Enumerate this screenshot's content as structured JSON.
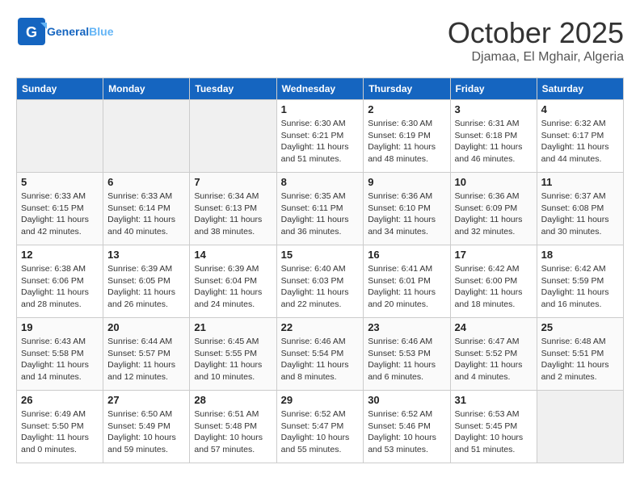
{
  "logo": {
    "text_general": "General",
    "text_blue": "Blue"
  },
  "title": {
    "month_year": "October 2025",
    "location": "Djamaa, El Mghair, Algeria"
  },
  "weekdays": [
    "Sunday",
    "Monday",
    "Tuesday",
    "Wednesday",
    "Thursday",
    "Friday",
    "Saturday"
  ],
  "weeks": [
    {
      "days": [
        {
          "num": "",
          "empty": true
        },
        {
          "num": "",
          "empty": true
        },
        {
          "num": "",
          "empty": true
        },
        {
          "num": "1",
          "sunrise": "Sunrise: 6:30 AM",
          "sunset": "Sunset: 6:21 PM",
          "daylight": "Daylight: 11 hours and 51 minutes."
        },
        {
          "num": "2",
          "sunrise": "Sunrise: 6:30 AM",
          "sunset": "Sunset: 6:19 PM",
          "daylight": "Daylight: 11 hours and 48 minutes."
        },
        {
          "num": "3",
          "sunrise": "Sunrise: 6:31 AM",
          "sunset": "Sunset: 6:18 PM",
          "daylight": "Daylight: 11 hours and 46 minutes."
        },
        {
          "num": "4",
          "sunrise": "Sunrise: 6:32 AM",
          "sunset": "Sunset: 6:17 PM",
          "daylight": "Daylight: 11 hours and 44 minutes."
        }
      ]
    },
    {
      "days": [
        {
          "num": "5",
          "sunrise": "Sunrise: 6:33 AM",
          "sunset": "Sunset: 6:15 PM",
          "daylight": "Daylight: 11 hours and 42 minutes."
        },
        {
          "num": "6",
          "sunrise": "Sunrise: 6:33 AM",
          "sunset": "Sunset: 6:14 PM",
          "daylight": "Daylight: 11 hours and 40 minutes."
        },
        {
          "num": "7",
          "sunrise": "Sunrise: 6:34 AM",
          "sunset": "Sunset: 6:13 PM",
          "daylight": "Daylight: 11 hours and 38 minutes."
        },
        {
          "num": "8",
          "sunrise": "Sunrise: 6:35 AM",
          "sunset": "Sunset: 6:11 PM",
          "daylight": "Daylight: 11 hours and 36 minutes."
        },
        {
          "num": "9",
          "sunrise": "Sunrise: 6:36 AM",
          "sunset": "Sunset: 6:10 PM",
          "daylight": "Daylight: 11 hours and 34 minutes."
        },
        {
          "num": "10",
          "sunrise": "Sunrise: 6:36 AM",
          "sunset": "Sunset: 6:09 PM",
          "daylight": "Daylight: 11 hours and 32 minutes."
        },
        {
          "num": "11",
          "sunrise": "Sunrise: 6:37 AM",
          "sunset": "Sunset: 6:08 PM",
          "daylight": "Daylight: 11 hours and 30 minutes."
        }
      ]
    },
    {
      "days": [
        {
          "num": "12",
          "sunrise": "Sunrise: 6:38 AM",
          "sunset": "Sunset: 6:06 PM",
          "daylight": "Daylight: 11 hours and 28 minutes."
        },
        {
          "num": "13",
          "sunrise": "Sunrise: 6:39 AM",
          "sunset": "Sunset: 6:05 PM",
          "daylight": "Daylight: 11 hours and 26 minutes."
        },
        {
          "num": "14",
          "sunrise": "Sunrise: 6:39 AM",
          "sunset": "Sunset: 6:04 PM",
          "daylight": "Daylight: 11 hours and 24 minutes."
        },
        {
          "num": "15",
          "sunrise": "Sunrise: 6:40 AM",
          "sunset": "Sunset: 6:03 PM",
          "daylight": "Daylight: 11 hours and 22 minutes."
        },
        {
          "num": "16",
          "sunrise": "Sunrise: 6:41 AM",
          "sunset": "Sunset: 6:01 PM",
          "daylight": "Daylight: 11 hours and 20 minutes."
        },
        {
          "num": "17",
          "sunrise": "Sunrise: 6:42 AM",
          "sunset": "Sunset: 6:00 PM",
          "daylight": "Daylight: 11 hours and 18 minutes."
        },
        {
          "num": "18",
          "sunrise": "Sunrise: 6:42 AM",
          "sunset": "Sunset: 5:59 PM",
          "daylight": "Daylight: 11 hours and 16 minutes."
        }
      ]
    },
    {
      "days": [
        {
          "num": "19",
          "sunrise": "Sunrise: 6:43 AM",
          "sunset": "Sunset: 5:58 PM",
          "daylight": "Daylight: 11 hours and 14 minutes."
        },
        {
          "num": "20",
          "sunrise": "Sunrise: 6:44 AM",
          "sunset": "Sunset: 5:57 PM",
          "daylight": "Daylight: 11 hours and 12 minutes."
        },
        {
          "num": "21",
          "sunrise": "Sunrise: 6:45 AM",
          "sunset": "Sunset: 5:55 PM",
          "daylight": "Daylight: 11 hours and 10 minutes."
        },
        {
          "num": "22",
          "sunrise": "Sunrise: 6:46 AM",
          "sunset": "Sunset: 5:54 PM",
          "daylight": "Daylight: 11 hours and 8 minutes."
        },
        {
          "num": "23",
          "sunrise": "Sunrise: 6:46 AM",
          "sunset": "Sunset: 5:53 PM",
          "daylight": "Daylight: 11 hours and 6 minutes."
        },
        {
          "num": "24",
          "sunrise": "Sunrise: 6:47 AM",
          "sunset": "Sunset: 5:52 PM",
          "daylight": "Daylight: 11 hours and 4 minutes."
        },
        {
          "num": "25",
          "sunrise": "Sunrise: 6:48 AM",
          "sunset": "Sunset: 5:51 PM",
          "daylight": "Daylight: 11 hours and 2 minutes."
        }
      ]
    },
    {
      "days": [
        {
          "num": "26",
          "sunrise": "Sunrise: 6:49 AM",
          "sunset": "Sunset: 5:50 PM",
          "daylight": "Daylight: 11 hours and 0 minutes."
        },
        {
          "num": "27",
          "sunrise": "Sunrise: 6:50 AM",
          "sunset": "Sunset: 5:49 PM",
          "daylight": "Daylight: 10 hours and 59 minutes."
        },
        {
          "num": "28",
          "sunrise": "Sunrise: 6:51 AM",
          "sunset": "Sunset: 5:48 PM",
          "daylight": "Daylight: 10 hours and 57 minutes."
        },
        {
          "num": "29",
          "sunrise": "Sunrise: 6:52 AM",
          "sunset": "Sunset: 5:47 PM",
          "daylight": "Daylight: 10 hours and 55 minutes."
        },
        {
          "num": "30",
          "sunrise": "Sunrise: 6:52 AM",
          "sunset": "Sunset: 5:46 PM",
          "daylight": "Daylight: 10 hours and 53 minutes."
        },
        {
          "num": "31",
          "sunrise": "Sunrise: 6:53 AM",
          "sunset": "Sunset: 5:45 PM",
          "daylight": "Daylight: 10 hours and 51 minutes."
        },
        {
          "num": "",
          "empty": true
        }
      ]
    }
  ]
}
